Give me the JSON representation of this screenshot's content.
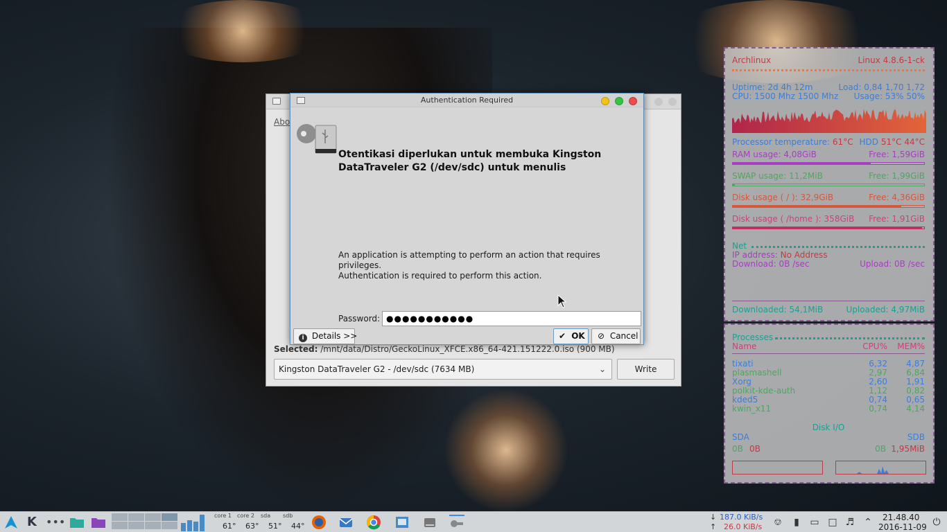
{
  "colors": {
    "dialog_bg": "#d6d6d6",
    "conky_border": "#8a5890",
    "taskbar_bg": "#d3d6d9"
  },
  "background_window": {
    "about_link": "Abo",
    "selected_label": "Selected:",
    "selected_path": "/mnt/data/Distro/GeckoLinux_XFCE.x86_64-421.151222.0.iso  (900 MB)",
    "device_select": "Kingston DataTraveler G2 - /dev/sdc (7634 MB)",
    "write_button": "Write"
  },
  "dialog": {
    "title": "Authentication Required",
    "heading": "Otentikasi diperlukan untuk membuka Kingston DataTraveler G2 (/dev/sdc) untuk menulis",
    "message_line1": "An application is attempting to perform an action that requires privileges.",
    "message_line2": "Authentication is required to perform this action.",
    "password_label": "Password:",
    "password_value": "●●●●●●●●●●●",
    "details_button": "Details >>",
    "ok_button": "OK",
    "cancel_button": "Cancel",
    "icons": [
      "key-icon",
      "usb-icon",
      "info-icon",
      "checkmark-icon",
      "cancel-icon"
    ]
  },
  "conky_system": {
    "hostname": "Archlinux",
    "kernel": "Linux 4.8.6-1-ck",
    "uptime_label": "Uptime:",
    "uptime_value": "2d 4h 12m",
    "load_label": "Load:",
    "load_value": "0,84 1,70 1,72",
    "cpu_label": "CPU:",
    "cpu_value": "1500 Mhz 1500 Mhz",
    "usage_label": "Usage:",
    "usage_value": "53% 50%",
    "proc_temp_label": "Processor temperature:",
    "proc_temp_value": "61°C",
    "hdd_label": "HDD",
    "hdd_value": "51°C  44°C",
    "ram_label": "RAM usage:",
    "ram_value": "4,08GiB",
    "ram_free_label": "Free:",
    "ram_free_value": "1,59GiB",
    "ram_fraction": 0.72,
    "swap_label": "SWAP usage:",
    "swap_value": "11,2MiB",
    "swap_free_label": "Free:",
    "swap_free_value": "1,99GiB",
    "swap_fraction": 0.01,
    "disk_root_label": "Disk usage ( / ):",
    "disk_root_value": "32,9GiB",
    "disk_root_free_label": "Free:",
    "disk_root_free_value": "4,36GiB",
    "disk_root_fraction": 0.88,
    "disk_home_label": "Disk usage ( /home ):",
    "disk_home_value": "358GiB",
    "disk_home_free_label": "Free:",
    "disk_home_free_value": "1,91GiB",
    "disk_home_fraction": 0.99,
    "net_label": "Net",
    "ip_label": "IP address:",
    "ip_value": "No Address",
    "download_label": "Download:",
    "download_value": "0B  /sec",
    "upload_label": "Upload:",
    "upload_value": "0B  /sec",
    "downloaded_label": "Downloaded:",
    "downloaded_value": "54,1MiB",
    "uploaded_label": "Uploaded:",
    "uploaded_value": "4,97MiB"
  },
  "conky_processes": {
    "title": "Processes",
    "col_name": "Name",
    "col_cpu": "CPU%",
    "col_mem": "MEM%",
    "rows": [
      {
        "name": "tixati",
        "cpu": "6,32",
        "mem": "4,87"
      },
      {
        "name": "plasmashell",
        "cpu": "2,97",
        "mem": "6,84"
      },
      {
        "name": "Xorg",
        "cpu": "2,60",
        "mem": "1,91"
      },
      {
        "name": "polkit-kde-auth",
        "cpu": "1,12",
        "mem": "0,82"
      },
      {
        "name": "kded5",
        "cpu": "0,74",
        "mem": "0,65"
      },
      {
        "name": "kwin_x11",
        "cpu": "0,74",
        "mem": "4,14"
      }
    ],
    "disk_io_label": "Disk I/O",
    "sda_label": "SDA",
    "sdb_label": "SDB",
    "sda_read": "0B",
    "sda_write": "0B",
    "sdb_read": "0B",
    "sdb_write": "1,95MiB"
  },
  "taskbar": {
    "core1_label": "core 1",
    "core2_label": "core 2",
    "sda_label": "sda",
    "sdb_label": "sdb",
    "core1_temp": "61°",
    "core2_temp": "63°",
    "sda_temp": "51°",
    "sdb_temp": "44°",
    "net_down": "187.0 KiB/s",
    "net_up": "26.0 KiB/s",
    "down_arrow": "↓",
    "up_arrow": "↑",
    "clock_time": "21.48.40",
    "clock_date": "2016-11-09",
    "launchers": [
      "arch-menu-icon",
      "kde-icon",
      "overflow-icon",
      "folder-icon",
      "folder-icon",
      "firefox-icon",
      "thunderbird-icon",
      "chrome-icon",
      "file-manager-icon",
      "disk-icon",
      "key-icon"
    ],
    "tray": [
      "usb-icon",
      "battery-icon",
      "monitor-icon",
      "clipboard-icon",
      "volume-icon",
      "chevron-up-icon",
      "power-icon"
    ]
  }
}
